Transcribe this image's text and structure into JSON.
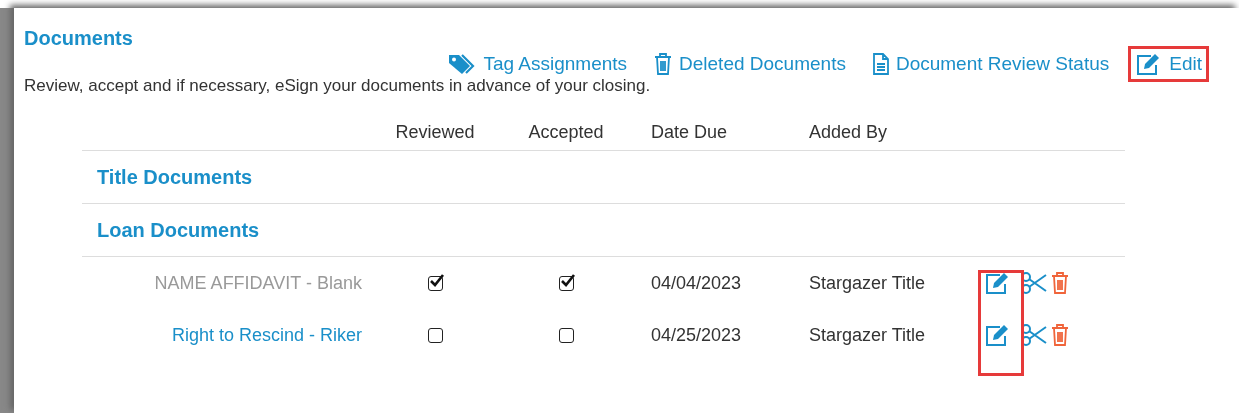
{
  "panel": {
    "title": "Documents",
    "description": "Review, accept and if necessary, eSign your documents in advance of your closing."
  },
  "actions": [
    {
      "kind": "tag",
      "label": "Tag Assignments",
      "highlighted": false
    },
    {
      "kind": "trash",
      "label": "Deleted Documents",
      "highlighted": false
    },
    {
      "kind": "file",
      "label": "Document Review Status",
      "highlighted": false
    },
    {
      "kind": "edit",
      "label": "Edit",
      "highlighted": true
    }
  ],
  "table": {
    "columns": [
      "Reviewed",
      "Accepted",
      "Date Due",
      "Added By"
    ],
    "edit_column_highlighted": true,
    "groups": [
      {
        "title": "Title Documents"
      },
      {
        "title": "Loan Documents",
        "rows": [
          {
            "name": "NAME AFFIDAVIT - Blank",
            "linked": false,
            "reviewed": true,
            "accepted": true,
            "date_due": "04/04/2023",
            "added_by": "Stargazer Title"
          },
          {
            "name": "Right to Rescind - Riker",
            "linked": true,
            "reviewed": false,
            "accepted": false,
            "date_due": "04/25/2023",
            "added_by": "Stargazer Title"
          }
        ]
      }
    ]
  }
}
